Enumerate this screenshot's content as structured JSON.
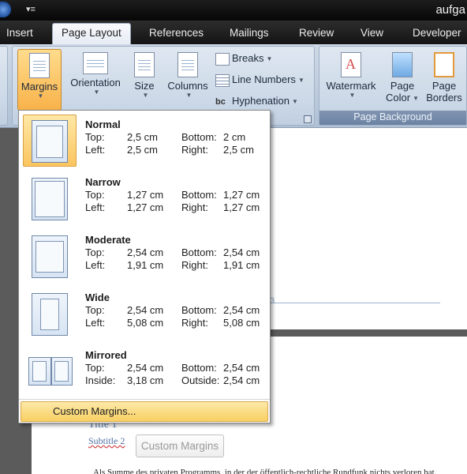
{
  "window": {
    "title": "aufga"
  },
  "tabs": [
    {
      "label": "Insert",
      "active": false
    },
    {
      "label": "Page Layout",
      "active": true
    },
    {
      "label": "References",
      "active": false
    },
    {
      "label": "Mailings",
      "active": false
    },
    {
      "label": "Review",
      "active": false
    },
    {
      "label": "View",
      "active": false
    },
    {
      "label": "Developer",
      "active": false
    }
  ],
  "ribbon": {
    "page_setup": {
      "margins": "Margins",
      "orientation": "Orientation",
      "size": "Size",
      "columns": "Columns",
      "breaks": "Breaks",
      "line_numbers": "Line Numbers",
      "hyphenation": "Hyphenation"
    },
    "page_background": {
      "label": "Page Background",
      "watermark": "Watermark",
      "page_color_1": "Page",
      "page_color_2": "Color",
      "page_borders_1": "Page",
      "page_borders_2": "Borders"
    }
  },
  "margins_menu": {
    "options": [
      {
        "name": "Normal",
        "l1": "Top:",
        "v1": "2,5 cm",
        "l2": "Bottom:",
        "v2": "2 cm",
        "l3": "Left:",
        "v3": "2,5 cm",
        "l4": "Right:",
        "v4": "2,5 cm"
      },
      {
        "name": "Narrow",
        "l1": "Top:",
        "v1": "1,27 cm",
        "l2": "Bottom:",
        "v2": "1,27 cm",
        "l3": "Left:",
        "v3": "1,27 cm",
        "l4": "Right:",
        "v4": "1,27 cm"
      },
      {
        "name": "Moderate",
        "l1": "Top:",
        "v1": "2,54 cm",
        "l2": "Bottom:",
        "v2": "2,54 cm",
        "l3": "Left:",
        "v3": "1,91 cm",
        "l4": "Right:",
        "v4": "1,91 cm"
      },
      {
        "name": "Wide",
        "l1": "Top:",
        "v1": "2,54 cm",
        "l2": "Bottom:",
        "v2": "2,54 cm",
        "l3": "Left:",
        "v3": "5,08 cm",
        "l4": "Right:",
        "v4": "5,08 cm"
      },
      {
        "name": "Mirrored",
        "l1": "Top:",
        "v1": "2,54 cm",
        "l2": "Bottom:",
        "v2": "2,54 cm",
        "l3": "Inside:",
        "v3": "3,18 cm",
        "l4": "Outside:",
        "v4": "2,54 cm"
      }
    ],
    "custom_label": "Custom Margins...",
    "selected": "Normal"
  },
  "document": {
    "page_number": "3",
    "title": "Title 1",
    "subtitle": "Subtitle 2",
    "body_text": "Als Summe des privaten Programms, in der der öffentlich-rechtliche Rundfunk nichts verloren hat."
  },
  "tooltip": {
    "label": "Custom Margins"
  }
}
